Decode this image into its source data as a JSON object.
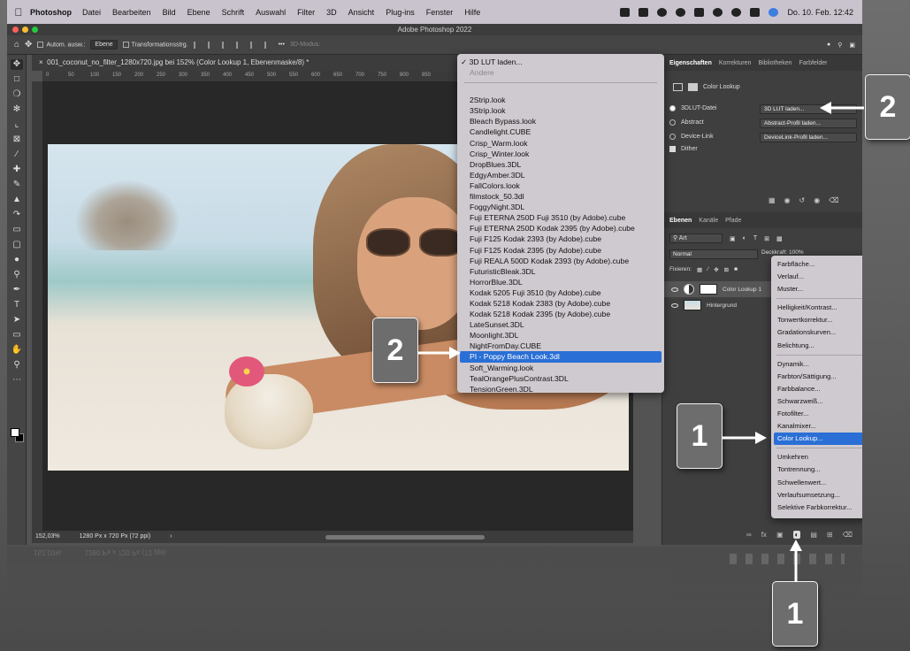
{
  "menubar": {
    "app_name": "Photoshop",
    "menus": [
      "Datei",
      "Bearbeiten",
      "Bild",
      "Ebene",
      "Schrift",
      "Auswahl",
      "Filter",
      "3D",
      "Ansicht",
      "Plug-ins",
      "Fenster",
      "Hilfe"
    ],
    "clock": "Do. 10. Feb.  12:42"
  },
  "window": {
    "title": "Adobe Photoshop 2022"
  },
  "options_bar": {
    "auto_select_label": "Autom. ausw.:",
    "auto_select_value": "Ebene",
    "transform_label": "Transformationsstrg.",
    "mode_3d_label": "3D-Modus:"
  },
  "document": {
    "tab_title": "001_coconut_no_filter_1280x720.jpg bei 152% (Color Lookup 1, Ebenenmaske/8) *",
    "ruler_marks": [
      "0",
      "50",
      "100",
      "150",
      "200",
      "250",
      "300",
      "350",
      "400",
      "450",
      "500",
      "550",
      "600",
      "650",
      "700",
      "750",
      "800",
      "850"
    ],
    "zoom": "152,03%",
    "doc_size": "1280 Px x 720 Px (72 ppi)"
  },
  "lut_menu": {
    "checked_item": "3D LUT laden...",
    "disabled_item": "Andere",
    "items": [
      "2Strip.look",
      "3Strip.look",
      "Bleach Bypass.look",
      "Candlelight.CUBE",
      "Crisp_Warm.look",
      "Crisp_Winter.look",
      "DropBlues.3DL",
      "EdgyAmber.3DL",
      "FallColors.look",
      "filmstock_50.3dl",
      "FoggyNight.3DL",
      "Fuji ETERNA 250D Fuji 3510 (by Adobe).cube",
      "Fuji ETERNA 250D Kodak 2395 (by Adobe).cube",
      "Fuji F125 Kodak 2393 (by Adobe).cube",
      "Fuji F125 Kodak 2395 (by Adobe).cube",
      "Fuji REALA 500D Kodak 2393 (by Adobe).cube",
      "FuturisticBleak.3DL",
      "HorrorBlue.3DL",
      "Kodak 5205 Fuji 3510 (by Adobe).cube",
      "Kodak 5218 Kodak 2383 (by Adobe).cube",
      "Kodak 5218 Kodak 2395 (by Adobe).cube",
      "LateSunset.3DL",
      "Moonlight.3DL",
      "NightFromDay.CUBE",
      "PI - Poppy Beach Look.3dl",
      "Soft_Warming.look",
      "TealOrangePlusContrast.3DL",
      "TensionGreen.3DL"
    ],
    "selected_index": 24
  },
  "properties_panel": {
    "tabs": [
      "Eigenschaften",
      "Korrekturen",
      "Bibliotheken",
      "Farbfelder"
    ],
    "header": "Color Lookup",
    "rows": [
      {
        "label": "3DLUT-Datei",
        "value": "3D LUT laden..."
      },
      {
        "label": "Abstract",
        "value": "Abstract-Profil laden..."
      },
      {
        "label": "Device-Link",
        "value": "DeviceLink-Profil laden..."
      }
    ],
    "dither_label": "Dither"
  },
  "layers_panel": {
    "tabs": [
      "Ebenen",
      "Kanäle",
      "Pfade"
    ],
    "kind_filter": "Art",
    "blend_mode": "Normal",
    "opacity_label": "Deckkraft: 100%",
    "lock_label": "Fixieren:",
    "layers": [
      {
        "name": "Color Lookup 1"
      },
      {
        "name": "Hintergrund"
      }
    ]
  },
  "adjust_menu": {
    "groups": [
      [
        "Farbfläche...",
        "Verlauf...",
        "Muster..."
      ],
      [
        "Helligkeit/Kontrast...",
        "Tonwertkorrektur...",
        "Gradationskurven...",
        "Belichtung..."
      ],
      [
        "Dynamik...",
        "Farbton/Sättigung...",
        "Farbbalance...",
        "Schwarzweiß...",
        "Fotofilter...",
        "Kanalmixer...",
        "Color Lookup..."
      ],
      [
        "Umkehren",
        "Tontrennung...",
        "Schwellenwert...",
        "Verlaufsumsetzung...",
        "Selektive Farbkorrektur..."
      ]
    ],
    "selected": "Color Lookup..."
  },
  "callouts": {
    "lut_dropdown": "2",
    "lut_item": "2",
    "adjust_menu_item": "1",
    "adjust_button": "1"
  },
  "colors": {
    "selection_blue": "#2a6fd6",
    "menu_bg": "#cfcacf",
    "panel_bg": "#3f3f3f",
    "callout_bg": "#6d6d6d"
  }
}
